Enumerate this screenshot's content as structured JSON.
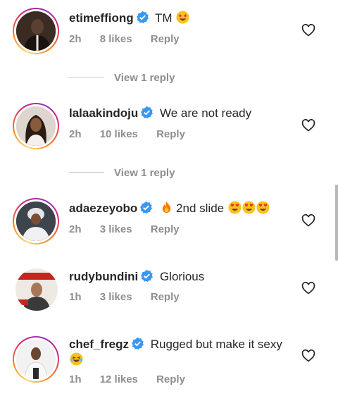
{
  "comments": [
    {
      "username": "etimeffiong",
      "text": "TM",
      "emojis": [
        "star-struck"
      ],
      "time": "2h",
      "likes": "8 likes",
      "reply": "Reply",
      "view_replies": "View 1 reply",
      "avatar_ring": true,
      "avatar_colors": [
        "#2b2118",
        "#5a4030"
      ]
    },
    {
      "username": "lalaakindoju",
      "text": "We are not ready",
      "emojis": [],
      "time": "2h",
      "likes": "10 likes",
      "reply": "Reply",
      "view_replies": "View 1 reply",
      "avatar_ring": true,
      "avatar_colors": [
        "#d9d4cf",
        "#4a3326"
      ]
    },
    {
      "username": "adaezeyobo",
      "text": "2nd slide",
      "emojis_before": [
        "fire"
      ],
      "emojis": [
        "heart-eyes",
        "heart-eyes",
        "heart-eyes"
      ],
      "time": "2h",
      "likes": "3 likes",
      "reply": "Reply",
      "avatar_ring": true,
      "avatar_colors": [
        "#3b4048",
        "#e8e8ec"
      ]
    },
    {
      "username": "rudybundini",
      "text": "Glorious",
      "emojis": [],
      "time": "1h",
      "likes": "3 likes",
      "reply": "Reply",
      "avatar_ring": false,
      "avatar_colors": [
        "#c2271f",
        "#3a3a3a"
      ]
    },
    {
      "username": "chef_fregz",
      "text": "Rugged but make it sexy",
      "emojis": [
        "laughing"
      ],
      "time": "1h",
      "likes": "12 likes",
      "reply": "Reply",
      "avatar_ring": true,
      "avatar_colors": [
        "#ececec",
        "#3c2a20"
      ]
    }
  ],
  "colors": {
    "verified": "#3897f0",
    "muted": "#8e8e8e",
    "text": "#262626"
  },
  "icons": {
    "verified": "verified-badge-icon",
    "like": "heart-outline-icon"
  }
}
